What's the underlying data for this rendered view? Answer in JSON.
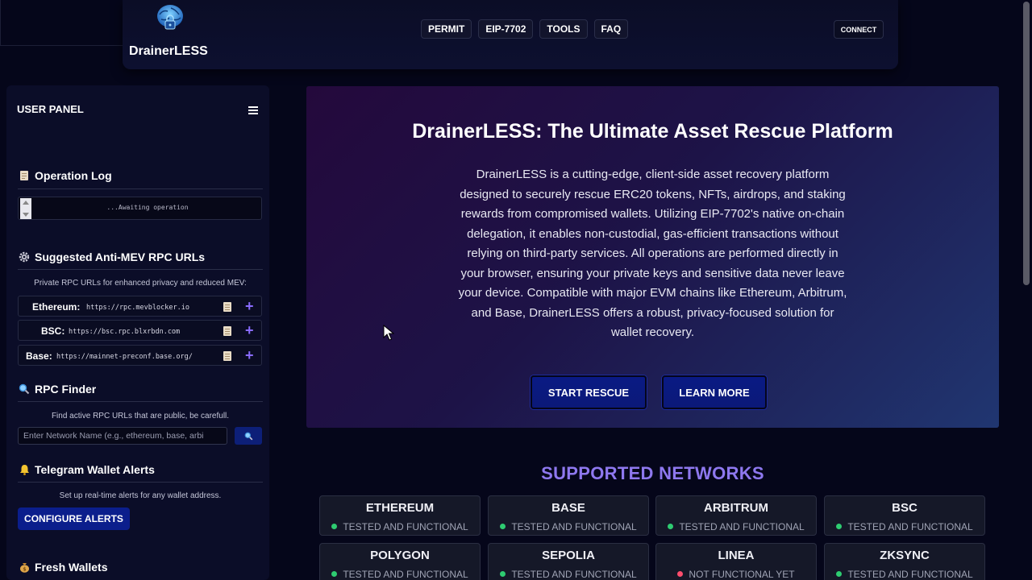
{
  "header": {
    "brand": "DrainerLESS",
    "nav": [
      "PERMIT",
      "EIP-7702",
      "TOOLS",
      "FAQ"
    ],
    "connect_label": "CONNECT"
  },
  "sidebar": {
    "title": "USER PANEL",
    "operation_log": {
      "title": "Operation Log",
      "status": "...Awaiting operation"
    },
    "anti_mev": {
      "title": "Suggested Anti-MEV RPC URLs",
      "hint": "Private RPC URLs for enhanced privacy and reduced MEV:",
      "rows": [
        {
          "name": "Ethereum:",
          "url": "https://rpc.mevblocker.io"
        },
        {
          "name": "BSC:",
          "url": "https://bsc.rpc.blxrbdn.com"
        },
        {
          "name": "Base:",
          "url": "https://mainnet-preconf.base.org/"
        }
      ]
    },
    "rpc_finder": {
      "title": "RPC Finder",
      "hint": "Find active RPC URLs that are public, be carefull.",
      "placeholder": "Enter Network Name (e.g., ethereum, base, arbi"
    },
    "telegram": {
      "title": "Telegram Wallet Alerts",
      "hint": "Set up real-time alerts for any wallet address.",
      "button": "CONFIGURE ALERTS"
    },
    "fresh_wallets": {
      "title": "Fresh Wallets"
    }
  },
  "hero": {
    "title": "DrainerLESS: The Ultimate Asset Rescue Platform",
    "description": "DrainerLESS is a cutting-edge, client-side asset recovery platform designed to securely rescue ERC20 tokens, NFTs, airdrops, and staking rewards from compromised wallets. Utilizing EIP-7702's native on-chain delegation, it enables non-custodial, gas-efficient transactions without relying on third-party services. All operations are performed directly in your browser, ensuring your private keys and sensitive data never leave your device. Compatible with major EVM chains like Ethereum, Arbitrum, and Base, DrainerLESS offers a robust, privacy-focused solution for wallet recovery.",
    "start_label": "START RESCUE",
    "learn_label": "LEARN MORE"
  },
  "networks": {
    "title": "SUPPORTED NETWORKS",
    "items": [
      {
        "name": "ETHEREUM",
        "status": "TESTED AND FUNCTIONAL",
        "color": "#2ecc71"
      },
      {
        "name": "BASE",
        "status": "TESTED AND FUNCTIONAL",
        "color": "#2ecc71"
      },
      {
        "name": "ARBITRUM",
        "status": "TESTED AND FUNCTIONAL",
        "color": "#2ecc71"
      },
      {
        "name": "BSC",
        "status": "TESTED AND FUNCTIONAL",
        "color": "#2ecc71"
      },
      {
        "name": "POLYGON",
        "status": "TESTED AND FUNCTIONAL",
        "color": "#2ecc71"
      },
      {
        "name": "SEPOLIA",
        "status": "TESTED AND FUNCTIONAL",
        "color": "#2ecc71"
      },
      {
        "name": "LINEA",
        "status": "NOT FUNCTIONAL YET",
        "color": "#ff4d6d"
      },
      {
        "name": "ZKSYNC",
        "status": "TESTED AND FUNCTIONAL",
        "color": "#2ecc71"
      }
    ]
  },
  "theme": {
    "accent": "#8e78ef",
    "button_blue": "#0b1e8c"
  }
}
